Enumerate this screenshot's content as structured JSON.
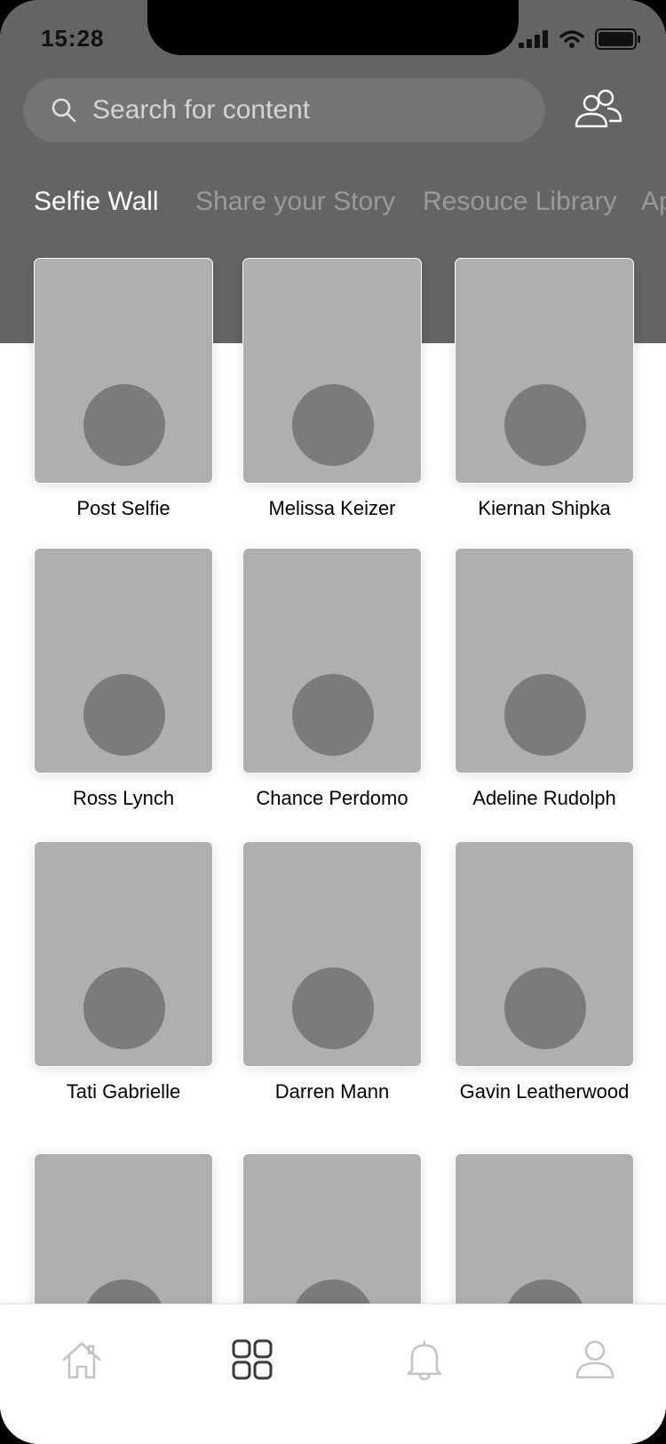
{
  "status_bar": {
    "time": "15:28"
  },
  "search": {
    "placeholder": "Search for content",
    "icon": "search-icon"
  },
  "header_actions": {
    "people_icon": "people-icon"
  },
  "tabs": [
    {
      "label": "Selfie Wall",
      "active": true
    },
    {
      "label": "Share your Story",
      "active": false
    },
    {
      "label": "Resouce Library",
      "active": false
    },
    {
      "label": "Ap",
      "active": false
    }
  ],
  "grid": {
    "items": [
      {
        "name": "Post Selfie"
      },
      {
        "name": "Melissa Keizer"
      },
      {
        "name": "Kiernan Shipka"
      },
      {
        "name": "Ross Lynch"
      },
      {
        "name": "Chance Perdomo"
      },
      {
        "name": "Adeline Rudolph"
      },
      {
        "name": "Tati Gabrielle"
      },
      {
        "name": "Darren Mann"
      },
      {
        "name": "Gavin Leatherwood"
      },
      {
        "name": ""
      },
      {
        "name": ""
      },
      {
        "name": ""
      }
    ]
  },
  "bottom_nav": {
    "items": [
      {
        "icon": "home-icon",
        "active": false
      },
      {
        "icon": "grid-icon",
        "active": true
      },
      {
        "icon": "bell-icon",
        "active": false
      },
      {
        "icon": "user-icon",
        "active": false
      }
    ]
  },
  "colors": {
    "header_bg": "#646464",
    "search_bg": "#747474",
    "card_bg": "#afafaf",
    "avatar_bg": "#7b7b7b",
    "tab_active": "#ffffff",
    "tab_inactive": "#9a9a9a"
  }
}
